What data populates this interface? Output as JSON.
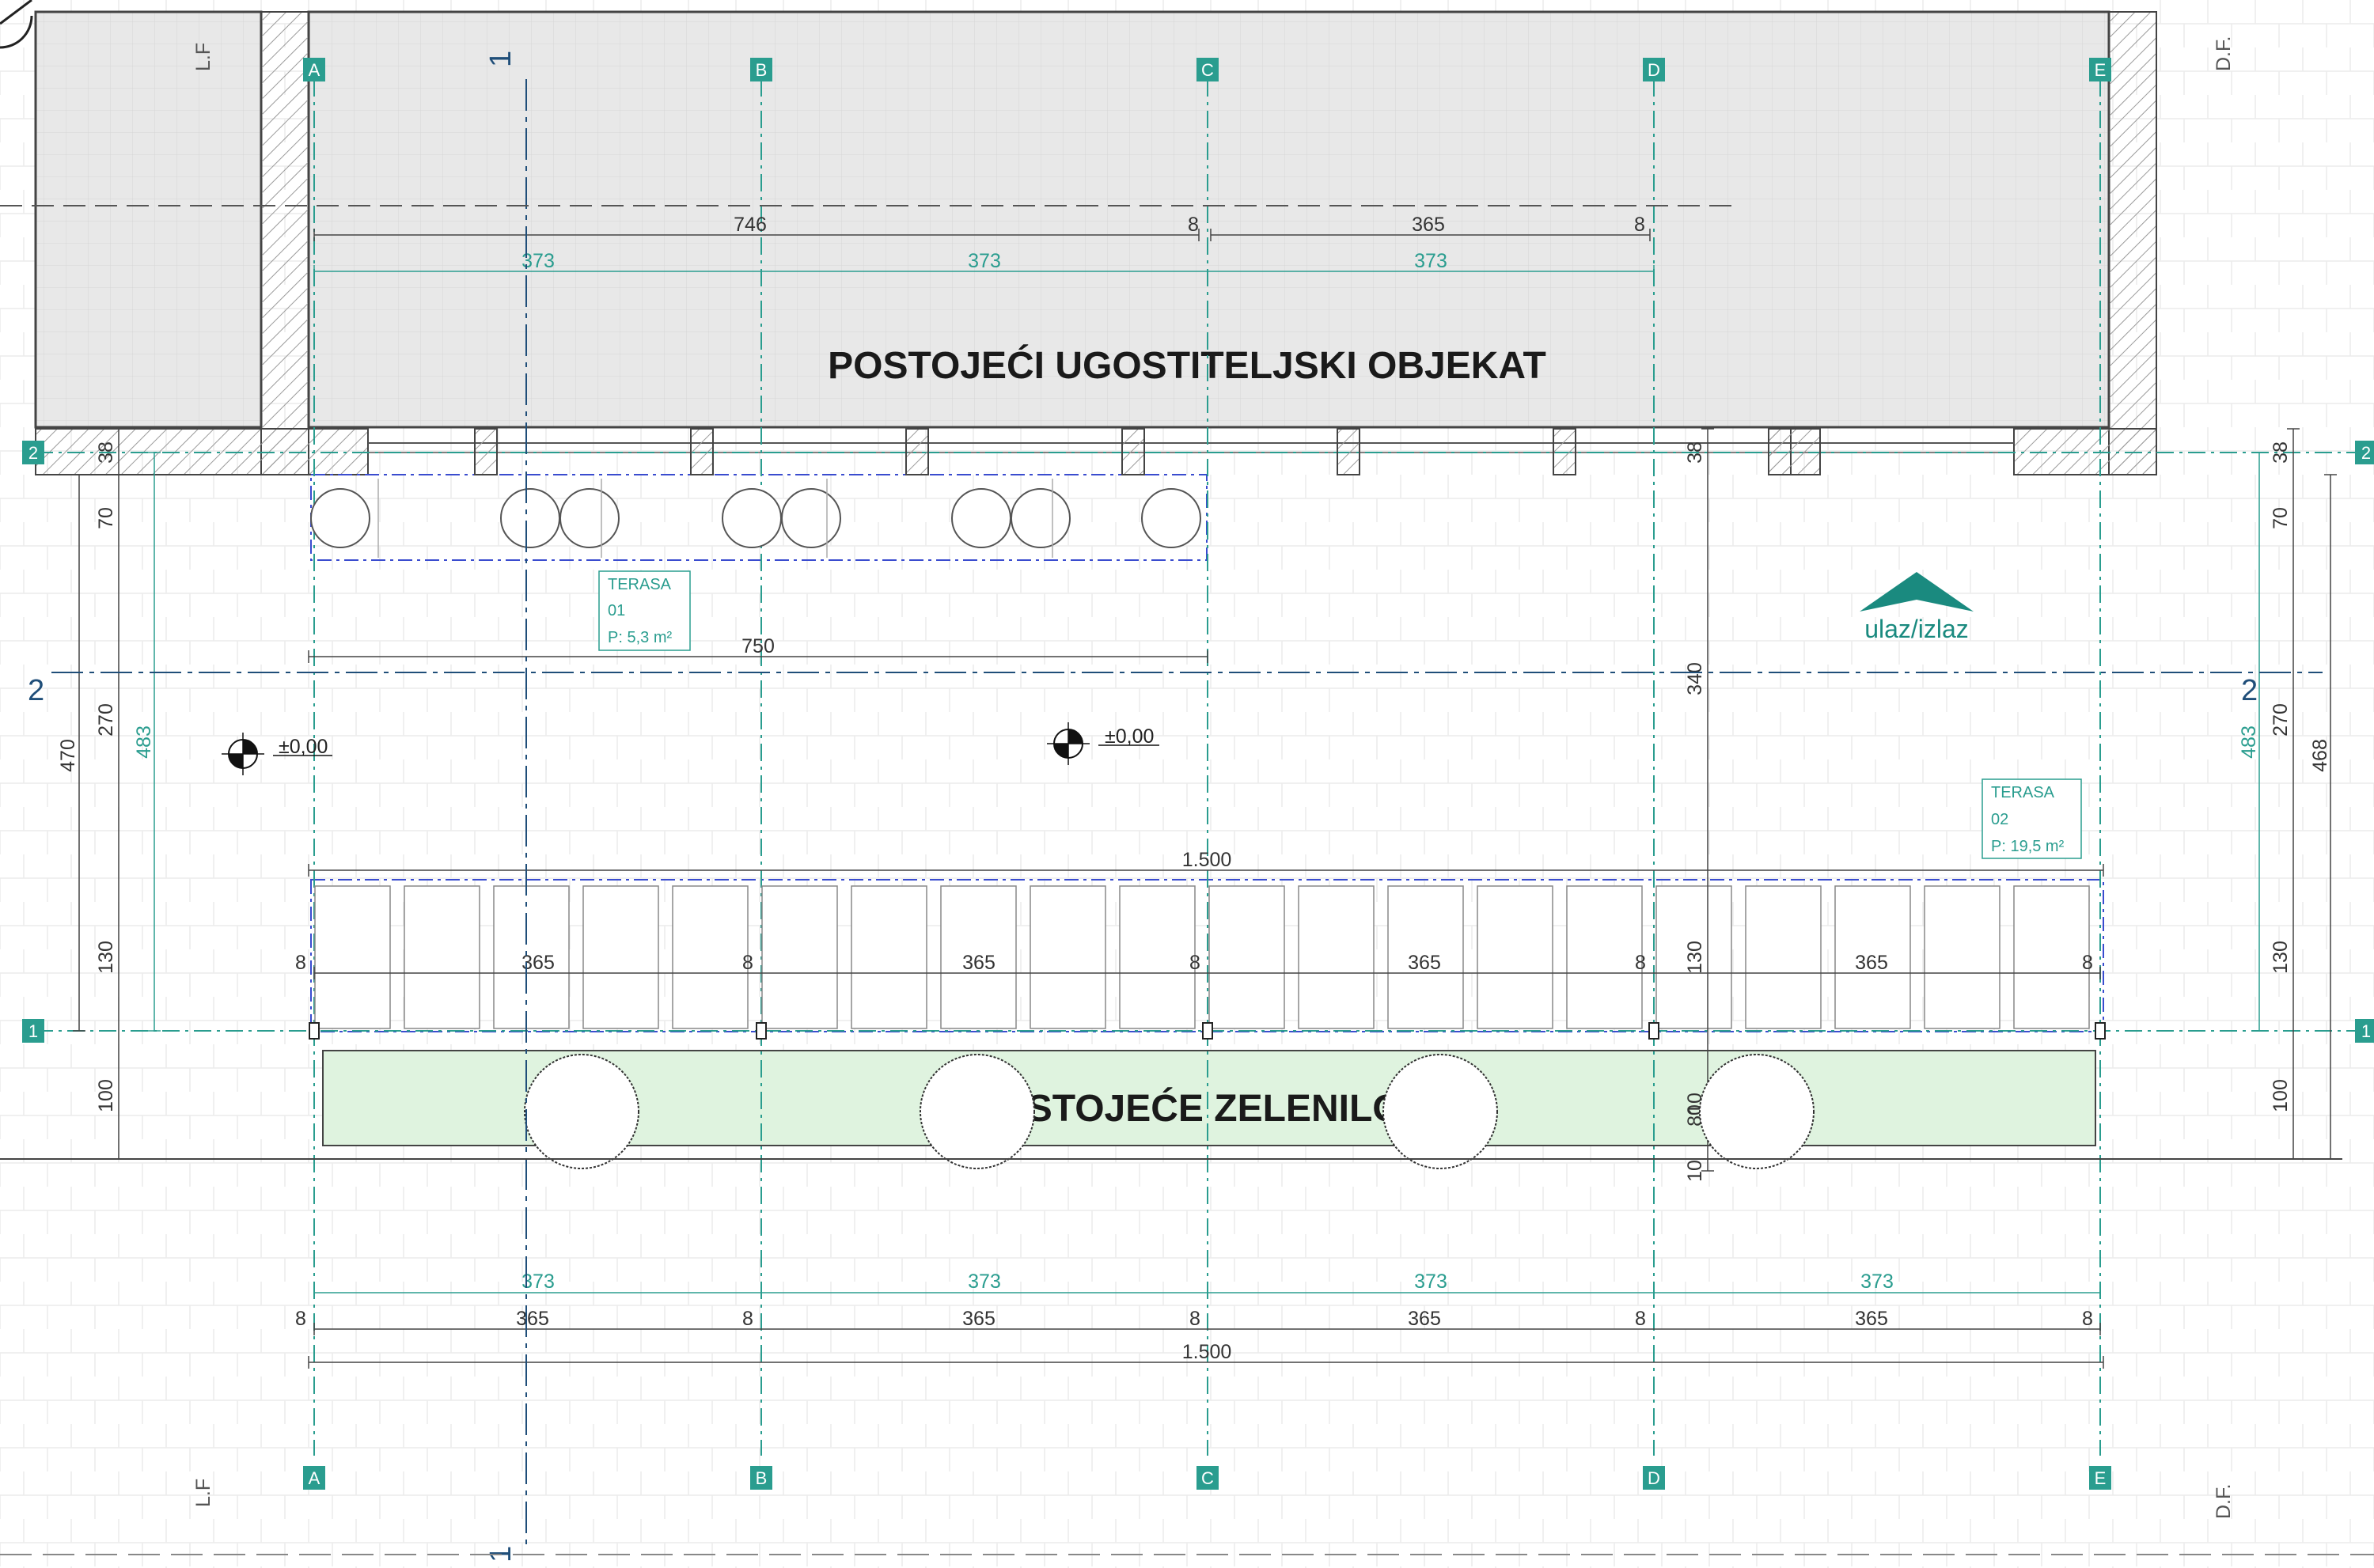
{
  "titles": {
    "building": "POSTOJEĆI UGOSTITELJSKI OBJEKAT",
    "greenery": "POSTOJEĆE ZELENILO"
  },
  "axes": {
    "columns": [
      "A",
      "B",
      "C",
      "D",
      "E"
    ],
    "rows": [
      "2",
      "1"
    ]
  },
  "section_marks": {
    "vertical": "1",
    "horizontal": "2"
  },
  "boundary_labels": {
    "left": "L.F",
    "right": "D.F."
  },
  "terraces": [
    {
      "name": "TERASA",
      "number": "01",
      "area": "P: 5,3 m²"
    },
    {
      "name": "TERASA",
      "number": "02",
      "area": "P: 19,5 m²"
    }
  ],
  "entry_label": "ulaz/izlaz",
  "levels": [
    "±0,00",
    "±0,00"
  ],
  "dimensions": {
    "top_black": [
      "746",
      "8",
      "365",
      "8"
    ],
    "top_teal": [
      "373",
      "373",
      "373"
    ],
    "mid_750": "750",
    "mid_340": "340",
    "total_1500": "1.500",
    "chain_365": [
      "365",
      "365",
      "365",
      "365"
    ],
    "chain_8": [
      "8",
      "8",
      "8",
      "8",
      "8"
    ],
    "bottom_teal": [
      "373",
      "373",
      "373",
      "373"
    ],
    "bottom_black": [
      "365",
      "365",
      "365",
      "365"
    ],
    "bottom_8": [
      "8",
      "8",
      "8",
      "8",
      "8"
    ],
    "bottom_total": "1.500",
    "left_chain": [
      "38",
      "70",
      "270",
      "130",
      "100"
    ],
    "left_470": "470",
    "left_teal_483": "483",
    "right_chain": [
      "38",
      "70",
      "270",
      "130",
      "100"
    ],
    "right_teal_483": "483",
    "right_468": "468",
    "d_chain": [
      "38",
      "340",
      "130",
      "10",
      "80",
      "10"
    ]
  },
  "colors": {
    "teal": "#2a9d8f",
    "building_fill": "#e8e8e8",
    "greenery_fill": "#dff3df",
    "section_blue": "#1f4e79"
  }
}
